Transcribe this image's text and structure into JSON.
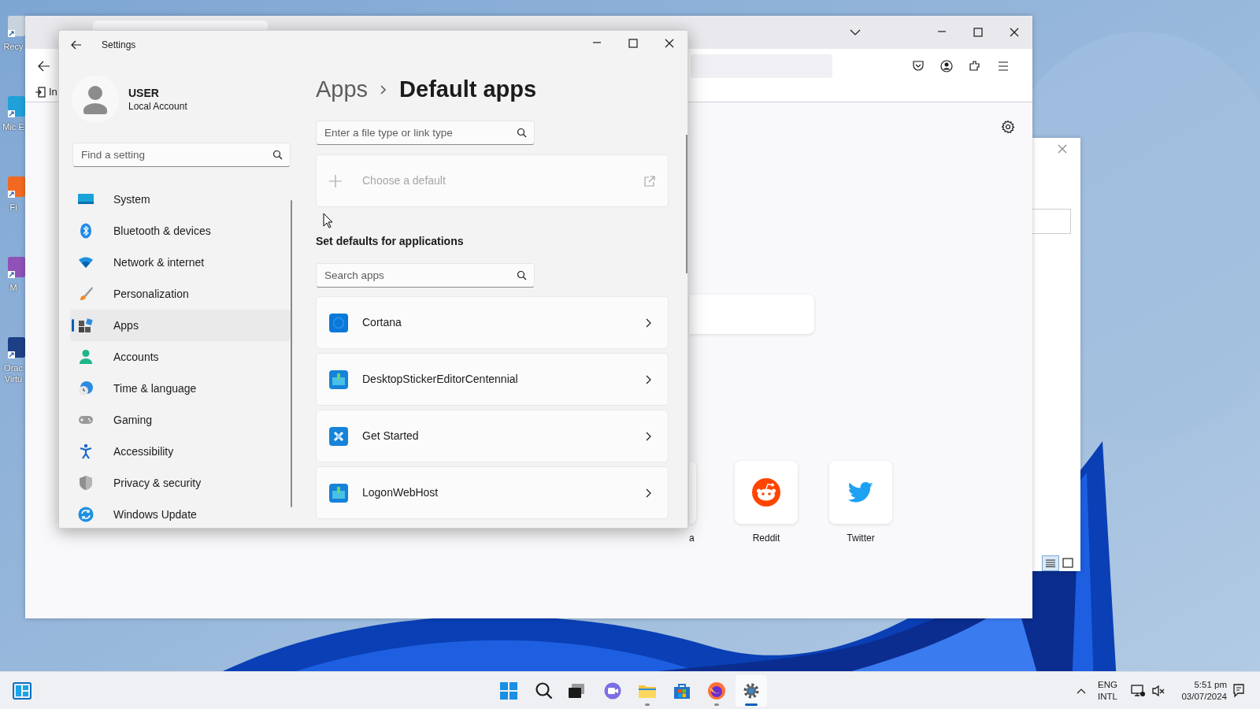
{
  "desktop": {
    "icons": [
      {
        "label": "Recy"
      },
      {
        "label": "Mic E"
      },
      {
        "label": "Fi"
      },
      {
        "label": "M"
      },
      {
        "label": "Orac Virtu"
      }
    ]
  },
  "browser": {
    "bookmark_text": "In",
    "shortcuts": [
      {
        "label": "a"
      },
      {
        "label": "Reddit"
      },
      {
        "label": "Twitter"
      }
    ]
  },
  "settings": {
    "window": {
      "title": "Settings"
    },
    "user": {
      "name": "USER",
      "account": "Local Account"
    },
    "search": {
      "placeholder": "Find a setting"
    },
    "nav": [
      {
        "label": "System",
        "selected": false
      },
      {
        "label": "Bluetooth & devices",
        "selected": false
      },
      {
        "label": "Network & internet",
        "selected": false
      },
      {
        "label": "Personalization",
        "selected": false
      },
      {
        "label": "Apps",
        "selected": true
      },
      {
        "label": "Accounts",
        "selected": false
      },
      {
        "label": "Time & language",
        "selected": false
      },
      {
        "label": "Gaming",
        "selected": false
      },
      {
        "label": "Accessibility",
        "selected": false
      },
      {
        "label": "Privacy & security",
        "selected": false
      },
      {
        "label": "Windows Update",
        "selected": false
      }
    ],
    "breadcrumb": {
      "parent": "Apps",
      "current": "Default apps"
    },
    "file_search": {
      "placeholder": "Enter a file type or link type"
    },
    "choose_default": {
      "label": "Choose a default",
      "disabled": true
    },
    "section_title": "Set defaults for applications",
    "app_search": {
      "placeholder": "Search apps"
    },
    "apps": [
      {
        "name": "Cortana"
      },
      {
        "name": "DesktopStickerEditorCentennial"
      },
      {
        "name": "Get Started"
      },
      {
        "name": "LogonWebHost"
      }
    ]
  },
  "taskbar": {
    "apps": [
      {
        "running": false,
        "selected": false
      },
      {
        "running": false,
        "selected": false
      },
      {
        "running": false,
        "selected": false
      },
      {
        "running": false,
        "selected": false
      },
      {
        "running": true,
        "selected": false
      },
      {
        "running": false,
        "selected": false
      },
      {
        "running": true,
        "selected": false
      },
      {
        "running": true,
        "selected": true
      }
    ],
    "language": "ENG",
    "layout": "INTL",
    "time": "5:51 pm",
    "date": "03/07/2024"
  }
}
